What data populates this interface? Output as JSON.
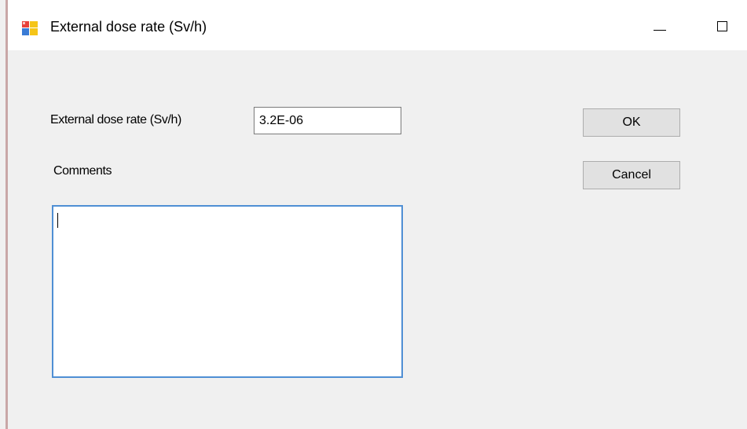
{
  "window": {
    "title": "External dose rate (Sv/h)",
    "icon": "form-window-icon",
    "controls": {
      "minimize_icon": "minimize-icon",
      "maximize_icon": "maximize-icon"
    }
  },
  "form": {
    "dose_rate_label": "External dose rate (Sv/h)",
    "dose_rate_value": "3.2E-06",
    "comments_label": "Comments",
    "comments_value": ""
  },
  "buttons": {
    "ok_label": "OK",
    "cancel_label": "Cancel"
  },
  "colors": {
    "window_background": "#f0f0f0",
    "titlebar_background": "#ffffff",
    "focus_border": "#4f8fd4",
    "button_background": "#e1e1e1"
  }
}
